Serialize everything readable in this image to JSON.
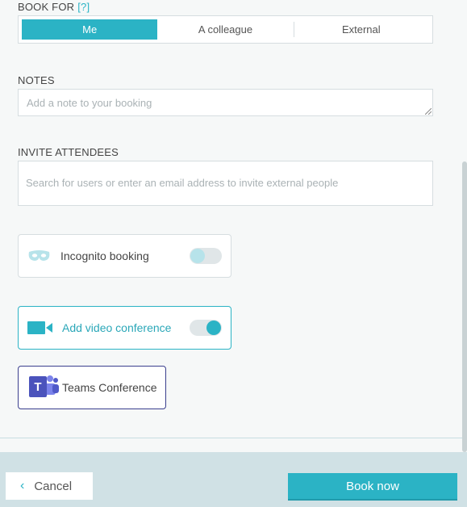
{
  "book_for": {
    "label": "BOOK FOR",
    "help": "[?]",
    "options": [
      "Me",
      "A colleague",
      "External"
    ],
    "selected": "Me"
  },
  "notes": {
    "label": "NOTES",
    "placeholder": "Add a note to your booking"
  },
  "invite": {
    "label": "INVITE ATTENDEES",
    "placeholder": "Search for users or enter an email address to invite external people"
  },
  "incognito": {
    "label": "Incognito booking",
    "enabled": false,
    "icon": "mask-icon"
  },
  "video": {
    "label": "Add video conference",
    "enabled": true,
    "icon": "video-camera-icon"
  },
  "teams": {
    "label": "Teams Conference",
    "icon": "teams-icon"
  },
  "footer": {
    "cancel_label": "Cancel",
    "book_label": "Book now"
  },
  "colors": {
    "accent": "#2bb3c5",
    "teams": "#4b53bc"
  }
}
